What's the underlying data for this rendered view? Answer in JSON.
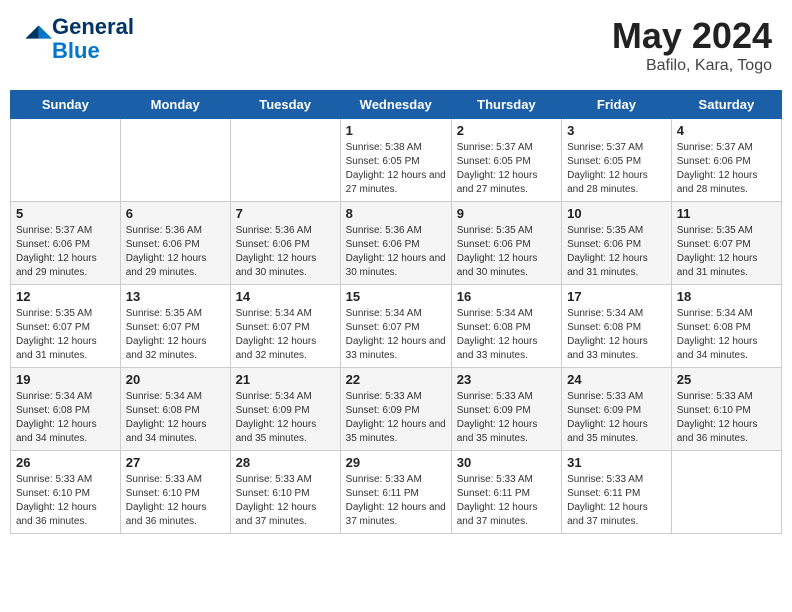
{
  "header": {
    "logo_line1": "General",
    "logo_line2": "Blue",
    "month_year": "May 2024",
    "location": "Bafilo, Kara, Togo"
  },
  "weekdays": [
    "Sunday",
    "Monday",
    "Tuesday",
    "Wednesday",
    "Thursday",
    "Friday",
    "Saturday"
  ],
  "weeks": [
    [
      {
        "day": "",
        "info": ""
      },
      {
        "day": "",
        "info": ""
      },
      {
        "day": "",
        "info": ""
      },
      {
        "day": "1",
        "info": "Sunrise: 5:38 AM\nSunset: 6:05 PM\nDaylight: 12 hours and 27 minutes."
      },
      {
        "day": "2",
        "info": "Sunrise: 5:37 AM\nSunset: 6:05 PM\nDaylight: 12 hours and 27 minutes."
      },
      {
        "day": "3",
        "info": "Sunrise: 5:37 AM\nSunset: 6:05 PM\nDaylight: 12 hours and 28 minutes."
      },
      {
        "day": "4",
        "info": "Sunrise: 5:37 AM\nSunset: 6:06 PM\nDaylight: 12 hours and 28 minutes."
      }
    ],
    [
      {
        "day": "5",
        "info": "Sunrise: 5:37 AM\nSunset: 6:06 PM\nDaylight: 12 hours and 29 minutes."
      },
      {
        "day": "6",
        "info": "Sunrise: 5:36 AM\nSunset: 6:06 PM\nDaylight: 12 hours and 29 minutes."
      },
      {
        "day": "7",
        "info": "Sunrise: 5:36 AM\nSunset: 6:06 PM\nDaylight: 12 hours and 30 minutes."
      },
      {
        "day": "8",
        "info": "Sunrise: 5:36 AM\nSunset: 6:06 PM\nDaylight: 12 hours and 30 minutes."
      },
      {
        "day": "9",
        "info": "Sunrise: 5:35 AM\nSunset: 6:06 PM\nDaylight: 12 hours and 30 minutes."
      },
      {
        "day": "10",
        "info": "Sunrise: 5:35 AM\nSunset: 6:06 PM\nDaylight: 12 hours and 31 minutes."
      },
      {
        "day": "11",
        "info": "Sunrise: 5:35 AM\nSunset: 6:07 PM\nDaylight: 12 hours and 31 minutes."
      }
    ],
    [
      {
        "day": "12",
        "info": "Sunrise: 5:35 AM\nSunset: 6:07 PM\nDaylight: 12 hours and 31 minutes."
      },
      {
        "day": "13",
        "info": "Sunrise: 5:35 AM\nSunset: 6:07 PM\nDaylight: 12 hours and 32 minutes."
      },
      {
        "day": "14",
        "info": "Sunrise: 5:34 AM\nSunset: 6:07 PM\nDaylight: 12 hours and 32 minutes."
      },
      {
        "day": "15",
        "info": "Sunrise: 5:34 AM\nSunset: 6:07 PM\nDaylight: 12 hours and 33 minutes."
      },
      {
        "day": "16",
        "info": "Sunrise: 5:34 AM\nSunset: 6:08 PM\nDaylight: 12 hours and 33 minutes."
      },
      {
        "day": "17",
        "info": "Sunrise: 5:34 AM\nSunset: 6:08 PM\nDaylight: 12 hours and 33 minutes."
      },
      {
        "day": "18",
        "info": "Sunrise: 5:34 AM\nSunset: 6:08 PM\nDaylight: 12 hours and 34 minutes."
      }
    ],
    [
      {
        "day": "19",
        "info": "Sunrise: 5:34 AM\nSunset: 6:08 PM\nDaylight: 12 hours and 34 minutes."
      },
      {
        "day": "20",
        "info": "Sunrise: 5:34 AM\nSunset: 6:08 PM\nDaylight: 12 hours and 34 minutes."
      },
      {
        "day": "21",
        "info": "Sunrise: 5:34 AM\nSunset: 6:09 PM\nDaylight: 12 hours and 35 minutes."
      },
      {
        "day": "22",
        "info": "Sunrise: 5:33 AM\nSunset: 6:09 PM\nDaylight: 12 hours and 35 minutes."
      },
      {
        "day": "23",
        "info": "Sunrise: 5:33 AM\nSunset: 6:09 PM\nDaylight: 12 hours and 35 minutes."
      },
      {
        "day": "24",
        "info": "Sunrise: 5:33 AM\nSunset: 6:09 PM\nDaylight: 12 hours and 35 minutes."
      },
      {
        "day": "25",
        "info": "Sunrise: 5:33 AM\nSunset: 6:10 PM\nDaylight: 12 hours and 36 minutes."
      }
    ],
    [
      {
        "day": "26",
        "info": "Sunrise: 5:33 AM\nSunset: 6:10 PM\nDaylight: 12 hours and 36 minutes."
      },
      {
        "day": "27",
        "info": "Sunrise: 5:33 AM\nSunset: 6:10 PM\nDaylight: 12 hours and 36 minutes."
      },
      {
        "day": "28",
        "info": "Sunrise: 5:33 AM\nSunset: 6:10 PM\nDaylight: 12 hours and 37 minutes."
      },
      {
        "day": "29",
        "info": "Sunrise: 5:33 AM\nSunset: 6:11 PM\nDaylight: 12 hours and 37 minutes."
      },
      {
        "day": "30",
        "info": "Sunrise: 5:33 AM\nSunset: 6:11 PM\nDaylight: 12 hours and 37 minutes."
      },
      {
        "day": "31",
        "info": "Sunrise: 5:33 AM\nSunset: 6:11 PM\nDaylight: 12 hours and 37 minutes."
      },
      {
        "day": "",
        "info": ""
      }
    ]
  ]
}
